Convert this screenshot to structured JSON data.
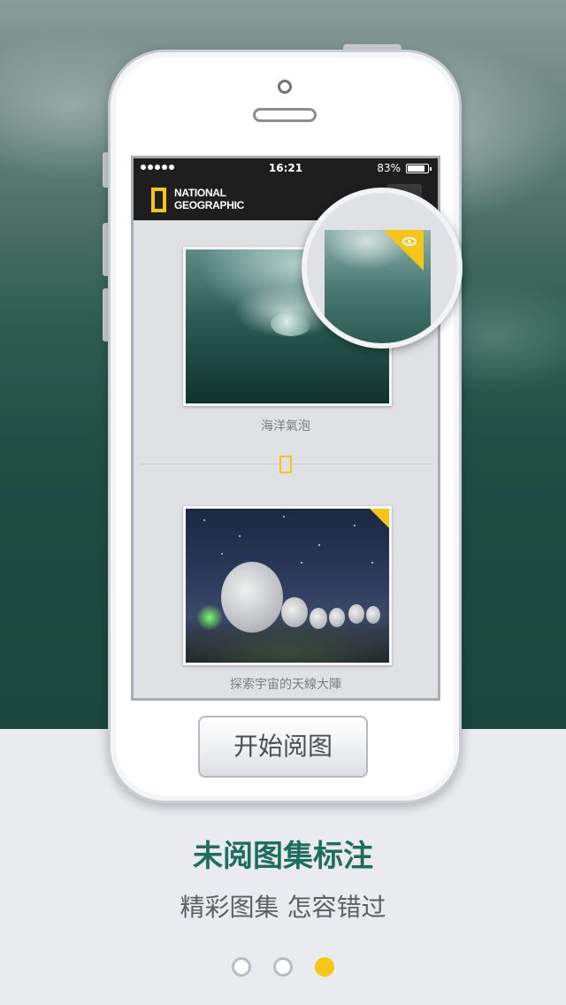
{
  "status_bar": {
    "time": "16:21",
    "battery": "83%"
  },
  "brand": {
    "line1": "NATIONAL",
    "line2": "GEOGRAPHIC"
  },
  "gallery": {
    "items": [
      {
        "caption": "海洋氣泡"
      },
      {
        "caption": "探索宇宙的天線大陣"
      }
    ]
  },
  "start_button": {
    "label": "开始阅图"
  },
  "feature": {
    "title": "未阅图集标注",
    "subtitle": "精彩图集 怎容错过"
  },
  "pager": {
    "count": 3,
    "active_index": 2
  },
  "colors": {
    "accent_yellow": "#f5c518",
    "title_green": "#1f6e5c",
    "nav_black": "#1e1e1e"
  }
}
